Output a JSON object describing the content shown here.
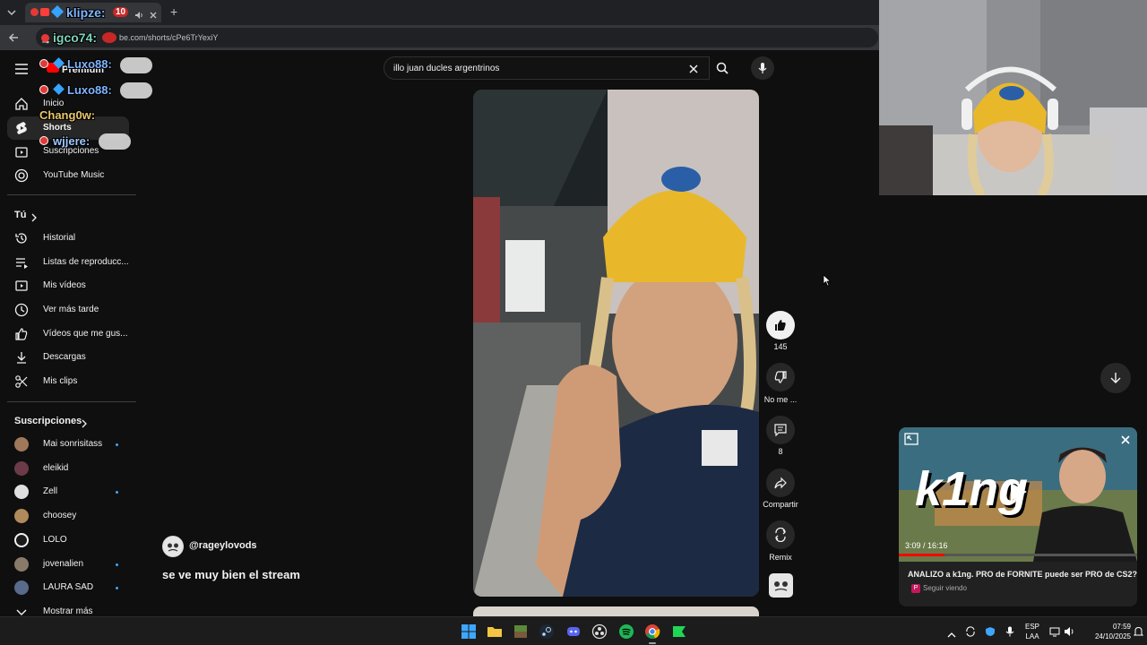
{
  "browser": {
    "tab_title": "klipze:",
    "tab_badge": "10",
    "url": "be.com/shorts/cPe6TrYexiY",
    "new_tab": "+",
    "overlay_user_label": "igco74:"
  },
  "chat_overlay": [
    {
      "user": "Luxo88:",
      "color": "#7fb6ff"
    },
    {
      "user": "Luxo88:",
      "color": "#7fb6ff"
    },
    {
      "user": "Chang0w:",
      "color": "#e8c66a"
    },
    {
      "user": "wjjere:",
      "color": "#9ec7ff"
    }
  ],
  "sidebar": {
    "premium": "Premium",
    "main_items": [
      {
        "label": "Inicio",
        "icon": "home-icon"
      },
      {
        "label": "Shorts",
        "icon": "shorts-icon"
      },
      {
        "label": "Suscripciones",
        "icon": "subscriptions-icon"
      },
      {
        "label": "YouTube Music",
        "icon": "music-icon"
      }
    ],
    "you_title": "Tú",
    "you_items": [
      {
        "label": "Historial",
        "icon": "history-icon"
      },
      {
        "label": "Listas de reproducc...",
        "icon": "playlist-icon"
      },
      {
        "label": "Mis vídeos",
        "icon": "my-videos-icon"
      },
      {
        "label": "Ver más tarde",
        "icon": "clock-icon"
      },
      {
        "label": "Vídeos que me gus...",
        "icon": "thumbs-up-icon"
      },
      {
        "label": "Descargas",
        "icon": "download-icon"
      },
      {
        "label": "Mis clips",
        "icon": "scissors-icon"
      }
    ],
    "subs_title": "Suscripciones",
    "subs": [
      {
        "label": "Mai sonrisitass",
        "dot": true,
        "color": "#a0785a"
      },
      {
        "label": "eleikid",
        "dot": false,
        "color": "#6b3b4a"
      },
      {
        "label": "Zell",
        "dot": true,
        "color": "#e0e0e0"
      },
      {
        "label": "choosey",
        "dot": false,
        "color": "#b08a5a"
      },
      {
        "label": "LOLO",
        "dot": false,
        "color": "#1a1a1a"
      },
      {
        "label": "jovenalien",
        "dot": true,
        "color": "#8a7a6a"
      },
      {
        "label": "LAURA SAD",
        "dot": true,
        "color": "#5a6a8a"
      }
    ],
    "show_more": "Mostrar más"
  },
  "search": {
    "query": "illo juan ducles argentrinos"
  },
  "short": {
    "channel": "@rageylovods",
    "comment": "se ve muy bien el stream"
  },
  "actions": {
    "likes": "145",
    "dislike": "No me ...",
    "comments": "8",
    "share": "Compartir",
    "remix": "Remix"
  },
  "miniplayer": {
    "thumb_text": "k1ng",
    "time": "3:09 / 16:16",
    "title": "ANALIZO a k1ng. PRO de FORNITE puede ser PRO de CS2?",
    "channel_badge": "P",
    "status": "Seguir viendo"
  },
  "taskbar": {
    "lang_top": "ESP",
    "lang_bottom": "LAA",
    "time": "07:59",
    "date": "24/10/2025"
  },
  "colors": {
    "accent": "#3ea6ff",
    "progress": "#ff0000",
    "cap_yellow": "#e8b82a"
  }
}
